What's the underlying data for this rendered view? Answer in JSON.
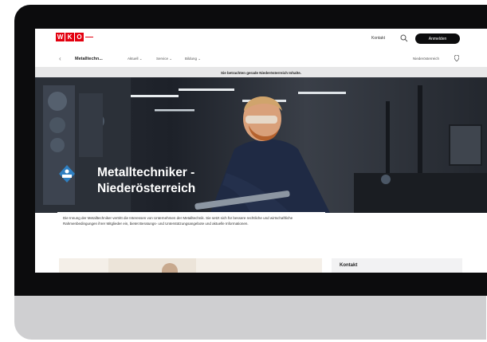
{
  "header": {
    "logo": {
      "letters": [
        "W",
        "K",
        "O"
      ],
      "mark": "—"
    },
    "kontakt_label": "Kontakt",
    "search_icon": "search-icon",
    "login_label": "Anmelden"
  },
  "nav": {
    "back_icon": "chevron-left-icon",
    "title": "Metalltechn...",
    "items": [
      {
        "label": "Aktuell ⌄"
      },
      {
        "label": "Service ⌄"
      },
      {
        "label": "Bildung ⌄"
      }
    ],
    "region": "Niederösterreich",
    "region_icon": "location-pin-icon"
  },
  "notice": {
    "text": "Sie betrachten gerade Niederösterreich Inhalte."
  },
  "hero": {
    "badge_icon": "innung-badge-icon",
    "title_line1": "Metalltechniker -",
    "title_line2": "Niederösterreich",
    "description": "Die Innung der Metalltechniker vertritt die Interessen von Unternehmen der Metalltechnik. Sie setzt sich für bessere rechtliche und wirtschaftliche Rahmenbedingungen ihrer Mitglieder ein, bietet Beratungs- und Unterstützungsangebote und aktuelle Informationen."
  },
  "content": {
    "kontakt_card_title": "Kontakt"
  },
  "colors": {
    "brand_red": "#e3000f",
    "button_dark": "#0c0c0d",
    "notice_bg": "#e7e7e8",
    "device_frame": "#0c0c0d",
    "device_body": "#cfcfd1"
  }
}
